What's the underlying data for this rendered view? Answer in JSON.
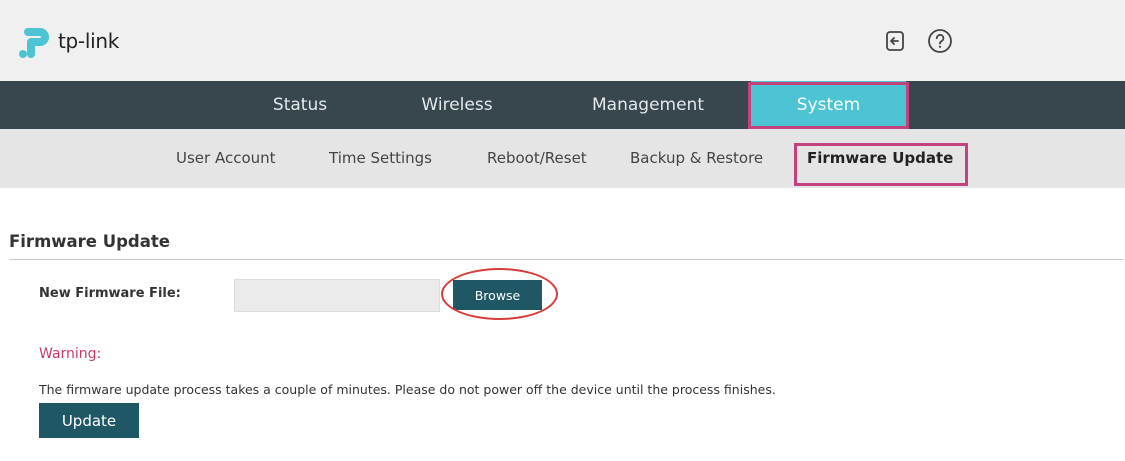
{
  "brand": {
    "name": "tp-link",
    "color": "#4cc4d3"
  },
  "header": {
    "icons": [
      "logout-icon",
      "help-icon"
    ]
  },
  "main_nav": {
    "tabs": [
      {
        "label": "Status"
      },
      {
        "label": "Wireless"
      },
      {
        "label": "Management"
      },
      {
        "label": "System",
        "active": true
      }
    ]
  },
  "sub_nav": {
    "items": [
      {
        "label": "User Account"
      },
      {
        "label": "Time Settings"
      },
      {
        "label": "Reboot/Reset"
      },
      {
        "label": "Backup & Restore"
      },
      {
        "label": "Firmware Update",
        "active": true
      }
    ]
  },
  "firmware": {
    "section_title": "Firmware Update",
    "field_label": "New Firmware File:",
    "file_value": "",
    "browse_label": "Browse",
    "warning_label": "Warning:",
    "warning_text": "The firmware update process takes a couple of minutes. Please do not power off the device until the process finishes.",
    "update_label": "Update"
  },
  "colors": {
    "nav_bg": "#38474e",
    "active_tab": "#4cc4d3",
    "button": "#1f5764",
    "highlight": "#c3427e",
    "warning": "#c23c6a",
    "annotation_circle": "#d83b3b"
  }
}
